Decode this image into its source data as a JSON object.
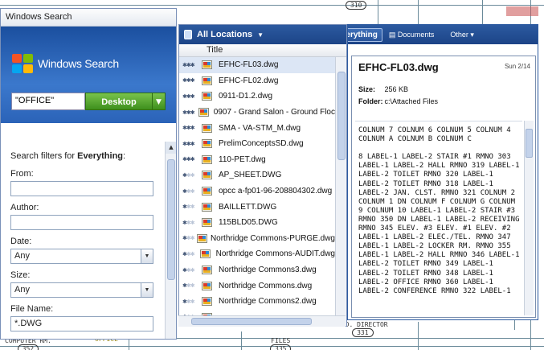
{
  "window": {
    "title": "Windows Search"
  },
  "brand": {
    "name": "Windows Search"
  },
  "search": {
    "query": "\"OFFICE\"",
    "scope_button": "Desktop"
  },
  "filters": {
    "heading_prefix": "Search filters for",
    "heading_target": "Everything",
    "heading_suffix": ":",
    "from_label": "From:",
    "from_value": "",
    "author_label": "Author:",
    "author_value": "",
    "date_label": "Date:",
    "date_value": "Any",
    "size_label": "Size:",
    "size_value": "Any",
    "filename_label": "File Name:",
    "filename_value": "*.DWG"
  },
  "results_header": {
    "location": "All Locations",
    "column_title": "Title"
  },
  "results": [
    {
      "name": "EFHC-FL03.dwg",
      "stars": 3,
      "selected": true
    },
    {
      "name": "EFHC-FL02.dwg",
      "stars": 3
    },
    {
      "name": "0911-D1.2.dwg",
      "stars": 3
    },
    {
      "name": "0907 - Grand Salon - Ground Floc",
      "stars": 3
    },
    {
      "name": "SMA - VA-STM_M.dwg",
      "stars": 3
    },
    {
      "name": "PrelimConceptsSD.dwg",
      "stars": 3
    },
    {
      "name": "110-PET.dwg",
      "stars": 3
    },
    {
      "name": "AP_SHEET.DWG",
      "stars": 1
    },
    {
      "name": "opcc a-fp01-96-208804302.dwg",
      "stars": 1
    },
    {
      "name": "BAILLETT.DWG",
      "stars": 1
    },
    {
      "name": "115BLD05.DWG",
      "stars": 1
    },
    {
      "name": "Northridge Commons-PURGE.dwg",
      "stars": 1
    },
    {
      "name": "Northridge Commons-AUDIT.dwg",
      "stars": 1
    },
    {
      "name": "Northridge Commons3.dwg",
      "stars": 1
    },
    {
      "name": "Northridge Commons.dwg",
      "stars": 1
    },
    {
      "name": "Northridge Commons2.dwg",
      "stars": 1
    },
    {
      "name": "",
      "stars": 1
    },
    {
      "name": "",
      "stars": 1
    }
  ],
  "tabs": {
    "everything": "Everything",
    "documents": "Documents",
    "other": "Other"
  },
  "preview": {
    "title": "EFHC-FL03.dwg",
    "date": "Sun 2/14",
    "size_label": "Size:",
    "size_value": "256 KB",
    "folder_label": "Folder:",
    "folder_value": "c:\\Attached Files",
    "body": "COLNUM 7 COLNUM 6 COLNUM 5 COLNUM 4 COLNUM A COLNUM B COLNUM C\n\n8 LABEL-1 LABEL-2 STAIR #1 RMNO 303 LABEL-1 LABEL-2 HALL RMNO 319 LABEL-1 LABEL-2 TOILET RMNO 320 LABEL-1 LABEL-2 TOILET RMNO 318 LABEL-1 LABEL-2 JAN. CLST. RMNO 321 COLNUM 2 COLNUM 1 DN COLNUM F COLNUM G COLNUM 9 COLNUM 10 LABEL-1 LABEL-2 STAIR #3 RMNO 350 DN LABEL-1 LABEL-2 RECEIVING RMNO 345 ELEV. #3 ELEV. #1 ELEV. #2 LABEL-1 LABEL-2 ELEC./TEL. RMNO 347 LABEL-1 LABEL-2 LOCKER RM. RMNO 355 LABEL-1 LABEL-2 HALL RMNO 346 LABEL-1 LABEL-2 TOILET RMNO 349 LABEL-1 LABEL-2 TOILET RMNO 348 LABEL-1 LABEL-2 OFFICE RMNO 360 LABEL-1 LABEL-2 CONFERENCE RMNO 322 LABEL-1"
  },
  "cad": {
    "top_tag": "310",
    "bottom_left_label": "COMPUTER RM.",
    "bottom_left_num": "352",
    "office_label": "OFFICE",
    "files_label": "FILES",
    "files_num": "335",
    "med_label": "MED. DIRECTOR",
    "med_num": "331"
  },
  "colors": {
    "accent": "#2c5aa0",
    "go_button": "#3d8f1d"
  }
}
